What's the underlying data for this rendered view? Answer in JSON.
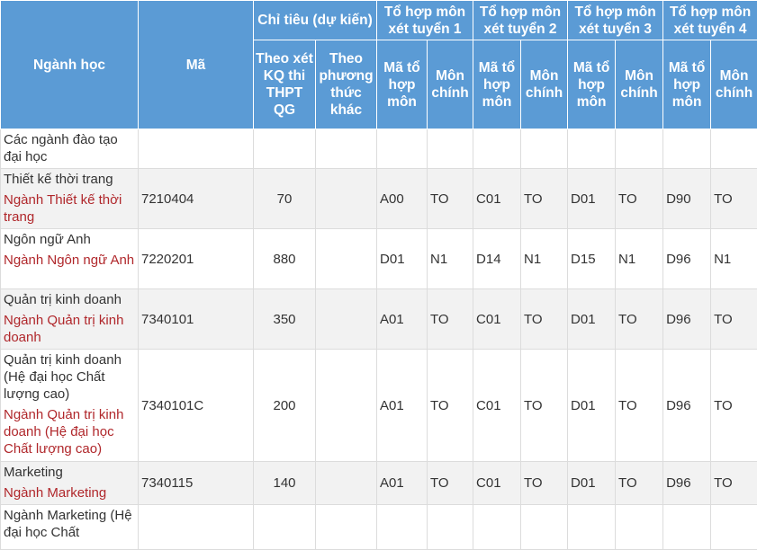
{
  "header": {
    "nganh_hoc": "Ngành học",
    "ma": "Mã",
    "chi_tieu": "Chỉ tiêu (dự kiến)",
    "theo_thpt": "Theo xét KQ thi THPT QG",
    "theo_khac": "Theo phương thức khác",
    "groups": [
      "Tổ hợp môn xét tuyển 1",
      "Tổ hợp môn xét tuyển 2",
      "Tổ hợp môn xét tuyển 3",
      "Tổ hợp môn xét tuyển 4"
    ],
    "ma_to_hop": "Mã tổ hợp môn",
    "mon_chinh": "Môn chính"
  },
  "rows": [
    {
      "name": "Các ngành đào tạo đại học",
      "link": "",
      "ma": "",
      "thpt": "",
      "khac": "",
      "g": [
        [
          "",
          ""
        ],
        [
          "",
          ""
        ],
        [
          "",
          ""
        ],
        [
          "",
          ""
        ]
      ]
    },
    {
      "name": "Thiết kế thời trang",
      "link": "Ngành Thiết kế thời trang",
      "ma": "7210404",
      "thpt": "70",
      "khac": "",
      "g": [
        [
          "A00",
          "TO"
        ],
        [
          "C01",
          "TO"
        ],
        [
          "D01",
          "TO"
        ],
        [
          "D90",
          "TO"
        ]
      ]
    },
    {
      "name": "Ngôn ngữ Anh",
      "link": "Ngành Ngôn ngữ Anh",
      "ma": "7220201",
      "thpt": "880",
      "khac": "",
      "g": [
        [
          "D01",
          "N1"
        ],
        [
          "D14",
          "N1"
        ],
        [
          "D15",
          "N1"
        ],
        [
          "D96",
          "N1"
        ]
      ]
    },
    {
      "name": "Quản trị kinh doanh",
      "link": "Ngành Quản trị kinh doanh",
      "ma": "7340101",
      "thpt": "350",
      "khac": "",
      "g": [
        [
          "A01",
          "TO"
        ],
        [
          "C01",
          "TO"
        ],
        [
          "D01",
          "TO"
        ],
        [
          "D96",
          "TO"
        ]
      ]
    },
    {
      "name": "Ngành Quản trị kinh doanh (Hệ đại học Chất lượng cao)",
      "link": "Ngành Quản trị kinh doanh (Hệ đại học Chất lượng cao)",
      "ma": "7340101C",
      "thpt": "200",
      "khac": "",
      "g": [
        [
          "A01",
          "TO"
        ],
        [
          "C01",
          "TO"
        ],
        [
          "D01",
          "TO"
        ],
        [
          "D96",
          "TO"
        ]
      ]
    },
    {
      "name": "Marketing",
      "link": "Ngành Marketing",
      "ma": "7340115",
      "thpt": "140",
      "khac": "",
      "g": [
        [
          "A01",
          "TO"
        ],
        [
          "C01",
          "TO"
        ],
        [
          "D01",
          "TO"
        ],
        [
          "D96",
          "TO"
        ]
      ]
    },
    {
      "name": "Ngành Marketing (Hệ đại học Chất",
      "link": "",
      "ma": "",
      "thpt": "",
      "khac": "",
      "g": [
        [
          "",
          ""
        ],
        [
          "",
          ""
        ],
        [
          "",
          ""
        ],
        [
          "",
          ""
        ]
      ]
    }
  ]
}
